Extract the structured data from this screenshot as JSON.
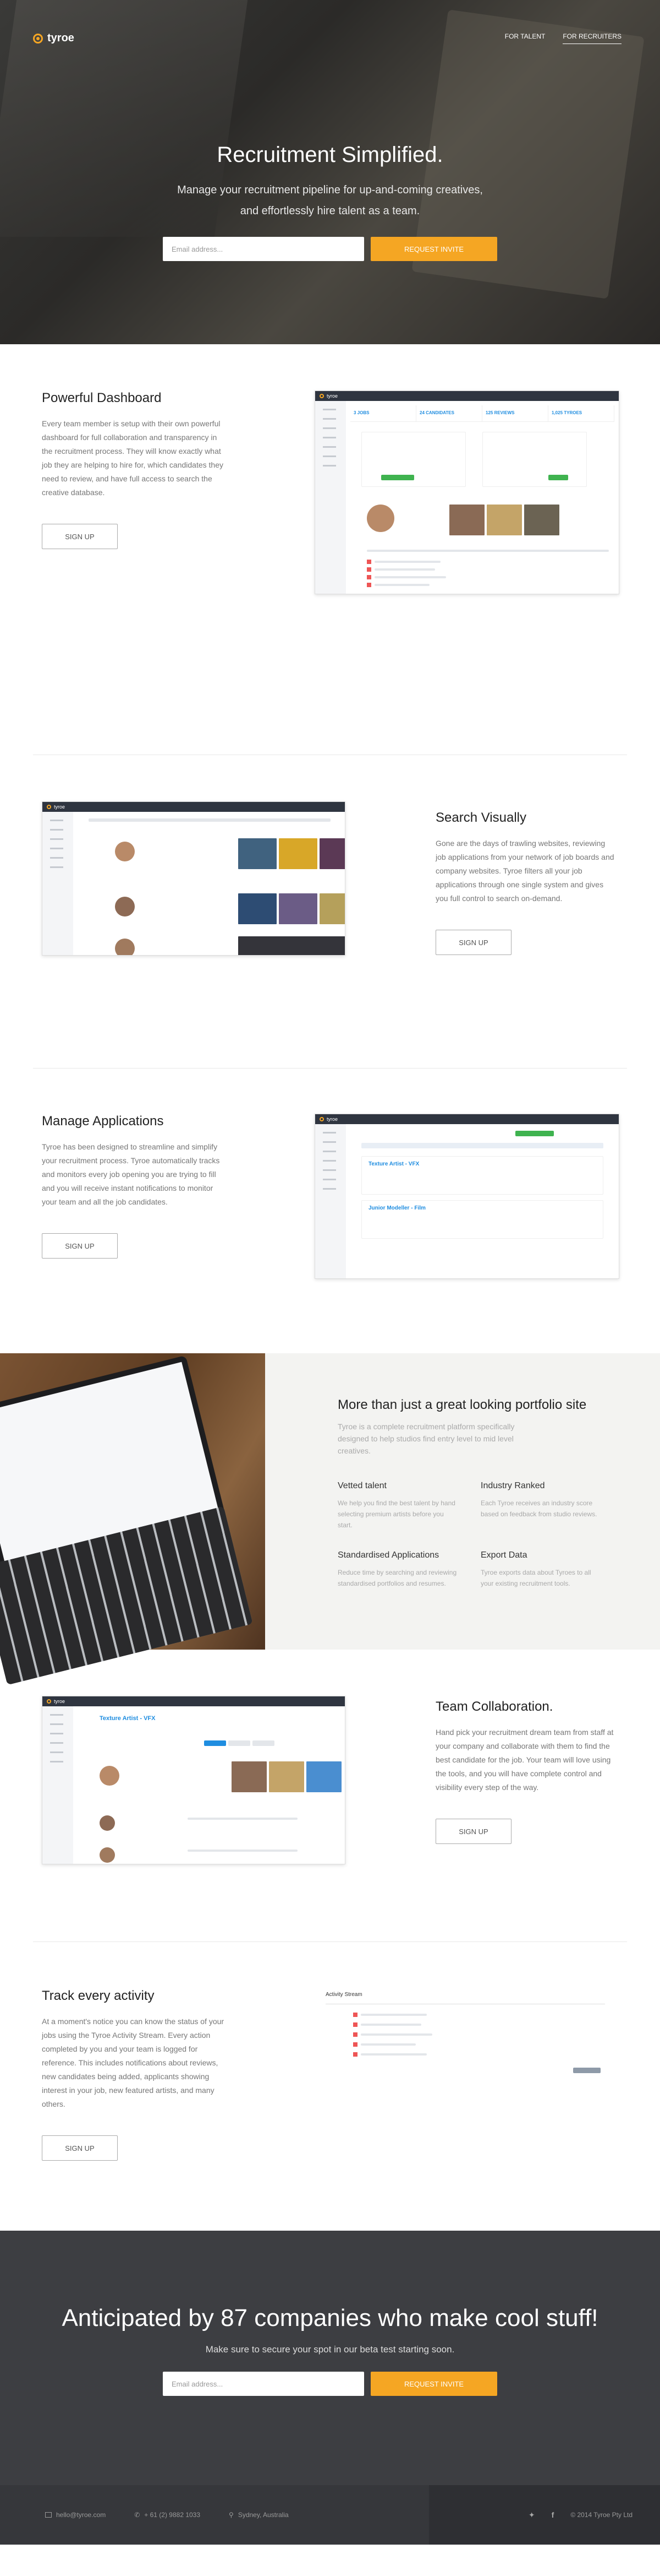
{
  "brand": "tyroe",
  "nav": {
    "talent": "FOR TALENT",
    "recruiters": "FOR RECRUITERS"
  },
  "hero": {
    "title": "Recruitment Simplified.",
    "line1": "Manage your recruitment pipeline for up-and-coming creatives,",
    "line2": "and effortlessly hire talent as a team.",
    "email_placeholder": "Email address...",
    "button": "REQUEST INVITE"
  },
  "dashboard": {
    "title": "Powerful Dashboard",
    "body": "Every team member is setup with their own powerful dashboard for full collaboration and transparency in the recruitment process. They will know exactly what job they are helping to hire for, which candidates they need to review, and have full access to search the creative database.",
    "button": "SIGN UP"
  },
  "search": {
    "title": "Search Visually",
    "body": "Gone are the days of trawling websites, reviewing job applications from your network of job boards and company websites. Tyroe filters all your job applications through one single system and gives you full control to search on-demand.",
    "button": "SIGN UP"
  },
  "manage": {
    "title": "Manage Applications",
    "body": "Tyroe has been designed to streamline and simplify your recruitment process. Tyroe automatically tracks and monitors every job opening you are trying to fill and you will receive instant notifications to monitor your team and all the job candidates.",
    "button": "SIGN UP"
  },
  "portfolio": {
    "title": "More than just a great looking portfolio site",
    "lead": "Tyroe is a complete recruitment platform specifically designed to help studios find entry level to mid level creatives.",
    "items": [
      {
        "title": "Vetted talent",
        "body": "We help you find the best talent by hand selecting premium artists before you start."
      },
      {
        "title": "Industry Ranked",
        "body": "Each Tyroe receives an industry score based on feedback from studio reviews."
      },
      {
        "title": "Standardised Applications",
        "body": "Reduce time by searching and reviewing standardised portfolios and resumes."
      },
      {
        "title": "Export Data",
        "body": "Tyroe exports data about Tyroes to all your existing recruitment tools."
      }
    ]
  },
  "team": {
    "title": "Team Collaboration.",
    "body": "Hand pick your recruitment dream team from staff at your company and collaborate with them to find the best candidate for the job. Your team will love using the tools, and you will have complete control and visibility every step of the way.",
    "button": "SIGN UP"
  },
  "track": {
    "title": "Track every activity",
    "body": "At a moment's notice you can know the status of your jobs using the Tyroe Activity Stream. Every action completed by you and your team is logged for reference. This includes notifications about reviews, new candidates being added, applicants showing interest in your job, new featured artists, and many others.",
    "button": "SIGN UP",
    "stream_title": "Activity Stream"
  },
  "cta": {
    "title": "Anticipated by 87 companies who make cool stuff!",
    "sub": "Make sure to secure your spot in our beta test starting soon.",
    "email_placeholder": "Email address...",
    "button": "REQUEST INVITE"
  },
  "footer": {
    "email": "hello@tyroe.com",
    "phone": "+ 61 (2) 9882 1033",
    "location": "Sydney, Australia",
    "copyright": "© 2014 Tyroe Pty Ltd"
  },
  "shots": {
    "stats": [
      "3 JOBS",
      "24 CANDIDATES",
      "125 REVIEWS",
      "1,025 TYROES"
    ],
    "job1": "Texture Artist - VFX",
    "job2": "Junior Modeller - Film"
  },
  "colors": {
    "accent": "#f5a623",
    "dark": "#2f3540",
    "blue": "#1f8de0"
  }
}
